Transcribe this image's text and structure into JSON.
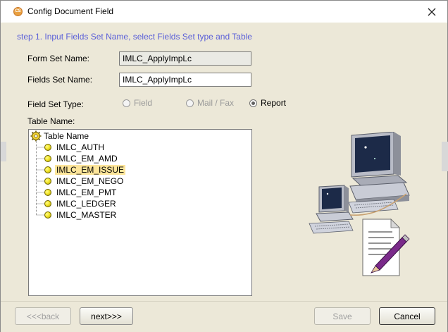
{
  "window": {
    "title": "Config Document Field",
    "app_icon_text": "CS",
    "close_glyph": "✕"
  },
  "step_text": "step 1. Input Fields Set Name, select Fields Set type and Table",
  "form_set": {
    "label": "Form Set Name:",
    "value": "IMLC_ApplyImpLc",
    "disabled": true
  },
  "fields_set": {
    "label": "Fields Set Name:",
    "value": "IMLC_ApplyImpLc"
  },
  "field_set_type": {
    "label": "Field Set Type:",
    "options": [
      {
        "label": "Field",
        "checked": false,
        "enabled": false
      },
      {
        "label": "Mail / Fax",
        "checked": false,
        "enabled": false
      },
      {
        "label": "Report",
        "checked": true,
        "enabled": true
      }
    ]
  },
  "table_name": {
    "label": "Table Name:",
    "root": "Table Name",
    "items": [
      "IMLC_AUTH",
      "IMLC_EM_AMD",
      "IMLC_EM_ISSUE",
      "IMLC_EM_NEGO",
      "IMLC_EM_PMT",
      "IMLC_LEDGER",
      "IMLC_MASTER"
    ],
    "selected": "IMLC_EM_ISSUE"
  },
  "buttons": {
    "back": "<<<back",
    "next": "next>>>",
    "save": "Save",
    "cancel": "Cancel"
  },
  "icons": {
    "app": "app-logo-icon",
    "close": "close-icon",
    "tree_root": "gear-tree-icon",
    "tree_item": "yellow-bullet-icon",
    "illustration": "computers-document-illustration"
  },
  "colors": {
    "step_text": "#5a5fd8",
    "selection": "#fde59a",
    "dialog_bg": "#ece8d8"
  }
}
